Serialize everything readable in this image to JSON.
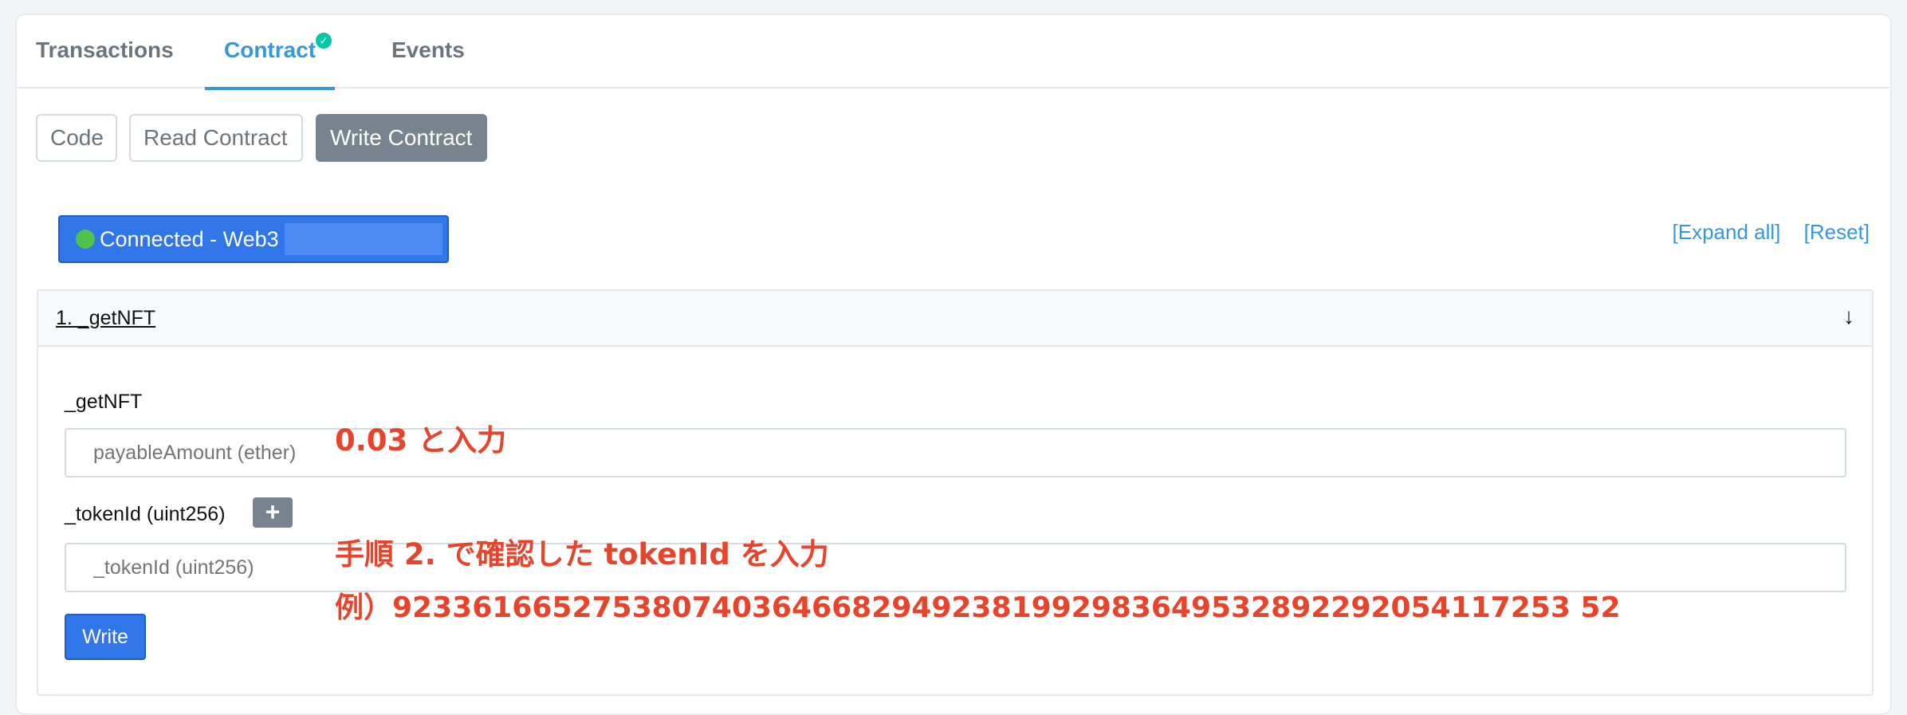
{
  "tabs": {
    "transactions": "Transactions",
    "contract": "Contract",
    "events": "Events",
    "contract_check": "✓"
  },
  "subtabs": {
    "code": "Code",
    "read": "Read Contract",
    "write": "Write Contract"
  },
  "connection": {
    "label": "Connected - Web3"
  },
  "links": {
    "expand": "[Expand all]",
    "reset": "[Reset]"
  },
  "method": {
    "title": "1. _getNFT",
    "arrow": "↓",
    "name": "_getNFT",
    "payable_placeholder": "payableAmount (ether)",
    "token_label": "_tokenId (uint256)",
    "token_placeholder": "_tokenId (uint256)",
    "plus": "+",
    "write_label": "Write"
  },
  "annotations": {
    "note1": "0.03 と入力",
    "note2": "手順 2. で確認した tokenId を入力",
    "note3": "例）92336166527538074036466829492381992983649532892292054117253 52"
  },
  "colors": {
    "accent": "#3498db",
    "button_primary": "#3076e8",
    "annotation": "#e8442c",
    "connected_dot": "#4ec24a"
  }
}
